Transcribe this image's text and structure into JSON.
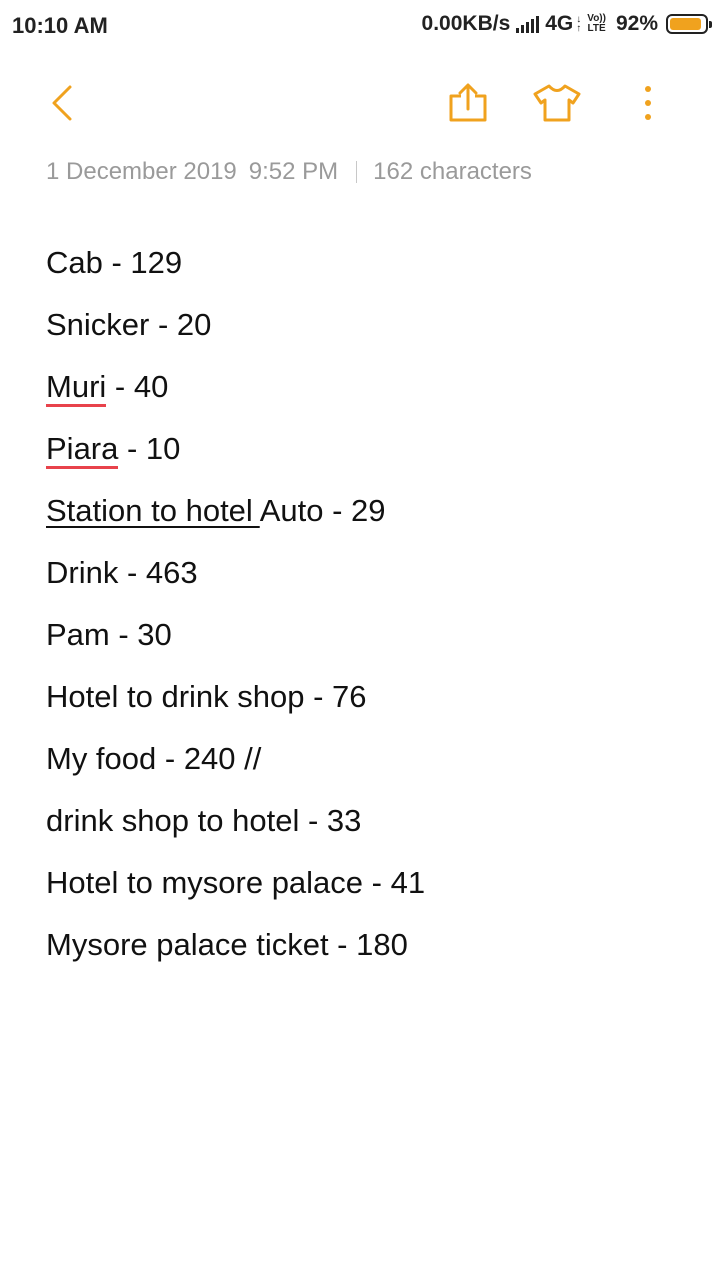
{
  "status_bar": {
    "time": "10:10 AM",
    "network_speed": "0.00KB/s",
    "network_type": "4G",
    "volte_top": "Vo))",
    "volte_bottom": "LTE",
    "battery_percent": "92%",
    "battery_level": 0.92,
    "battery_color": "#f0a21e"
  },
  "toolbar": {
    "accent_color": "#f0a21e",
    "icons": [
      "back-icon",
      "share-icon",
      "theme-tshirt-icon",
      "more-vertical-icon"
    ]
  },
  "meta": {
    "date": "1 December 2019",
    "time": "9:52 PM",
    "characters": "162 characters"
  },
  "note": {
    "lines": [
      {
        "pre": "",
        "marked": "",
        "rest": "Cab - 129"
      },
      {
        "pre": "",
        "marked": "",
        "rest": "Snicker - 20"
      },
      {
        "pre": "",
        "marked": "Muri",
        "rest": " - 40"
      },
      {
        "pre": "",
        "marked": "Piara",
        "rest": " - 10"
      },
      {
        "pre": "Station to hotel ",
        "marked": "",
        "rest": "Auto - 29"
      },
      {
        "pre": "",
        "marked": "",
        "rest": "Drink - 463"
      },
      {
        "pre": "",
        "marked": "",
        "rest": "Pam - 30"
      },
      {
        "pre": "",
        "marked": "",
        "rest": "Hotel to drink shop - 76"
      },
      {
        "pre": "",
        "marked": "",
        "rest": "My food - 240 //"
      },
      {
        "pre": "",
        "marked": "",
        "rest": "drink shop to hotel - 33"
      },
      {
        "pre": "",
        "marked": "",
        "rest": "Hotel to mysore palace - 41"
      },
      {
        "pre": "",
        "marked": "",
        "rest": "Mysore palace ticket - 180"
      }
    ]
  }
}
